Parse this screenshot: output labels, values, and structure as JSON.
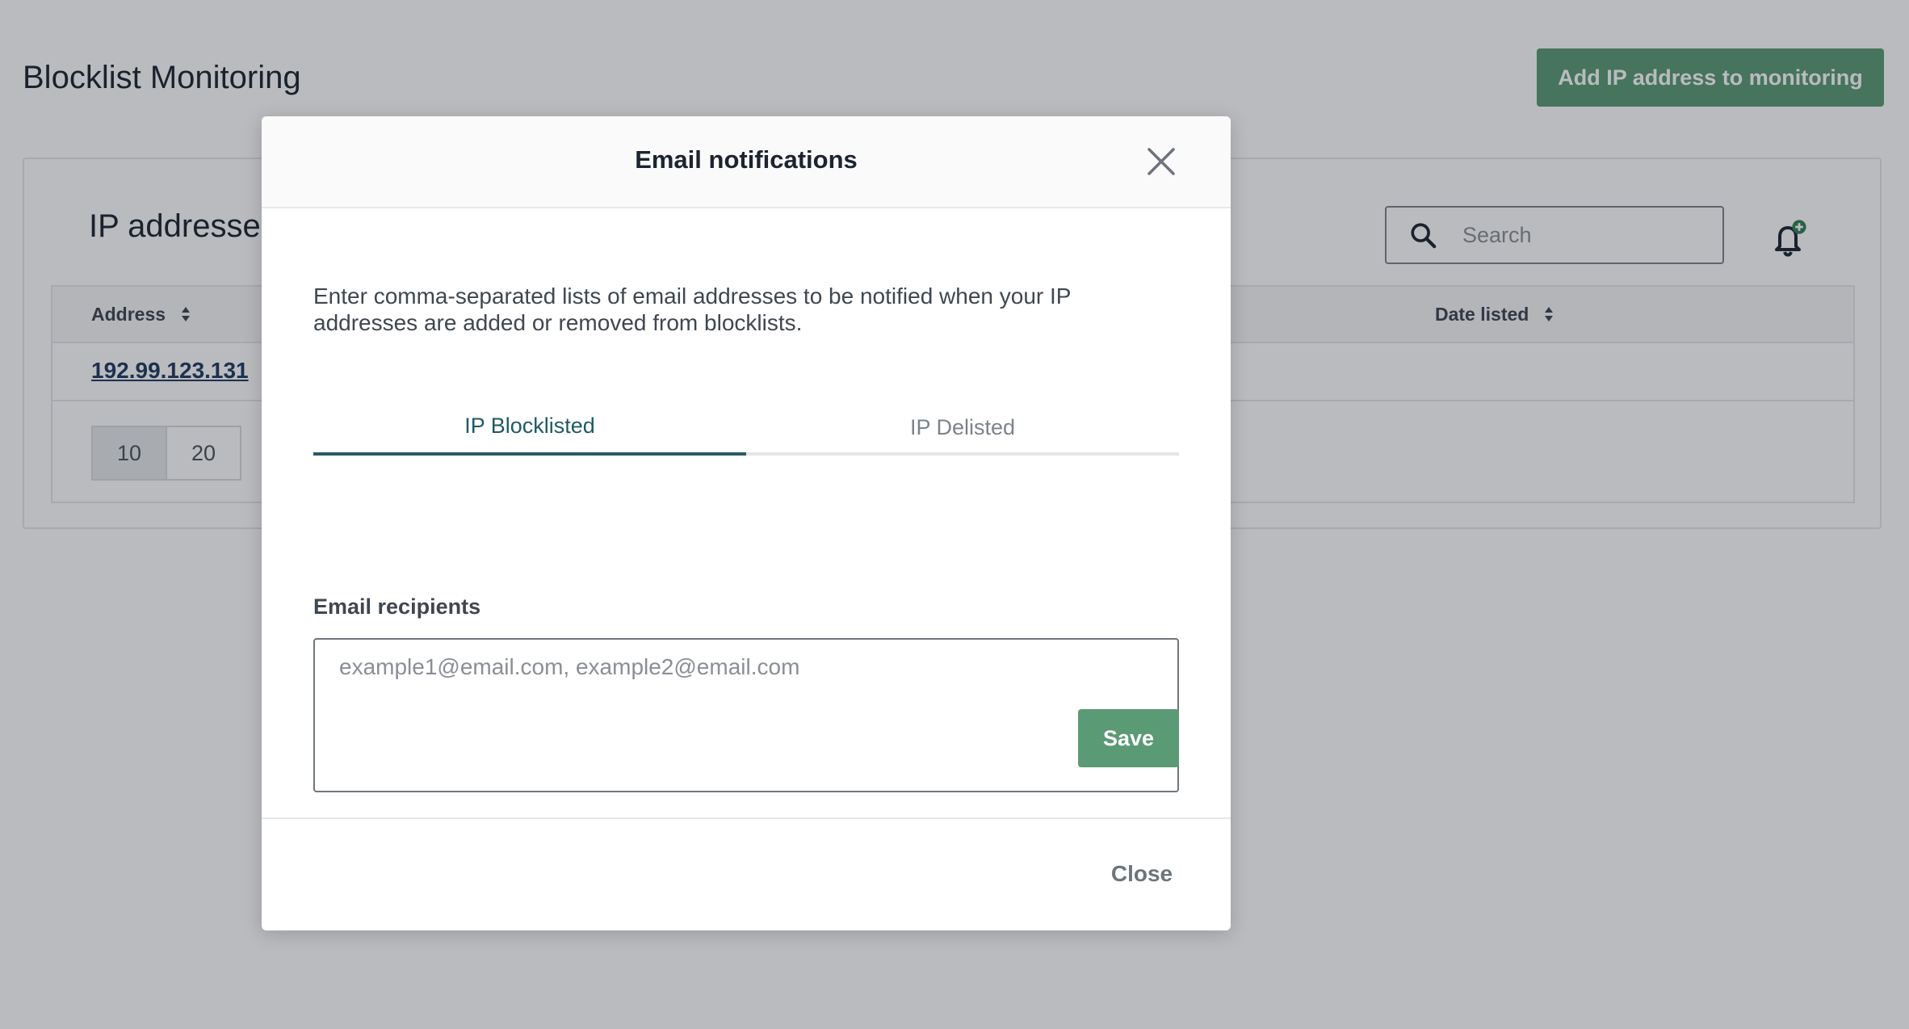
{
  "page": {
    "title": "Blocklist Monitoring",
    "add_button_label": "Add IP address to monitoring"
  },
  "card": {
    "title": "IP addresses",
    "search_placeholder": "Search",
    "columns": [
      "Address",
      "Date listed"
    ],
    "rows": [
      {
        "address": "192.99.123.131",
        "date_listed": ""
      }
    ],
    "page_sizes": [
      "10",
      "20"
    ],
    "active_page_size": "10"
  },
  "icons": {
    "search": "search-icon",
    "bell": "bell-plus-icon",
    "sort": "sort-icon",
    "close": "close-icon"
  },
  "modal": {
    "title": "Email notifications",
    "description": "Enter comma-separated lists of email addresses to be notified when your IP addresses are added or removed from blocklists.",
    "tabs": [
      {
        "label": "IP Blocklisted",
        "active": true
      },
      {
        "label": "IP Delisted",
        "active": false
      }
    ],
    "recipients_label": "Email recipients",
    "recipients_placeholder": "example1@email.com, example2@email.com",
    "recipients_value": "",
    "save_label": "Save",
    "close_label": "Close"
  },
  "colors": {
    "primary": "#5a9a74",
    "tab_active": "#2b5a66",
    "link": "#1f3a5f"
  }
}
